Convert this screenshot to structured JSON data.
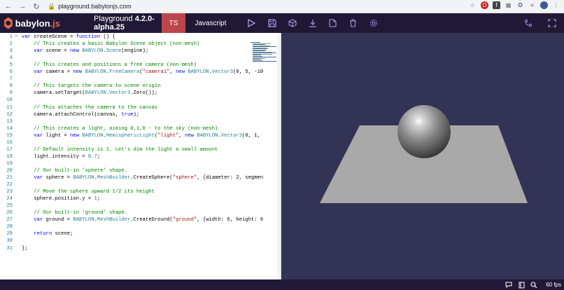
{
  "browser": {
    "url": "playground.babylonjs.com"
  },
  "header": {
    "logo_text": "babylon",
    "logo_suffix": ".js",
    "title_prefix": "Playground ",
    "version": "4.2.0-alpha.25",
    "tab_ts": "TS",
    "tab_js": "Javascript"
  },
  "editor": {
    "lines": [
      {
        "n": "1",
        "fold": "v",
        "parts": [
          [
            "kw",
            "var "
          ],
          [
            "",
            "createScene = "
          ],
          [
            "kw",
            "function"
          ],
          [
            "",
            " () {"
          ]
        ]
      },
      {
        "n": "2",
        "parts": [
          [
            "",
            "    "
          ],
          [
            "cm",
            "// This creates a basic Babylon Scene object (non-mesh)"
          ]
        ]
      },
      {
        "n": "3",
        "parts": [
          [
            "",
            "    "
          ],
          [
            "kw",
            "var "
          ],
          [
            "",
            "scene = "
          ],
          [
            "kw",
            "new "
          ],
          [
            "cls",
            "BABYLON"
          ],
          [
            "",
            "."
          ],
          [
            "cls",
            "Scene"
          ],
          [
            "",
            "(engine);"
          ]
        ]
      },
      {
        "n": "4",
        "parts": []
      },
      {
        "n": "5",
        "parts": [
          [
            "",
            "    "
          ],
          [
            "cm",
            "// This creates and positions a free camera (non-mesh)"
          ]
        ]
      },
      {
        "n": "6",
        "parts": [
          [
            "",
            "    "
          ],
          [
            "kw",
            "var "
          ],
          [
            "",
            "camera = "
          ],
          [
            "kw",
            "new "
          ],
          [
            "cls",
            "BABYLON"
          ],
          [
            "",
            "."
          ],
          [
            "cls",
            "FreeCamera"
          ],
          [
            "",
            "("
          ],
          [
            "str",
            "\"camera1\""
          ],
          [
            ",",
            ", "
          ],
          [
            "kw",
            "new "
          ],
          [
            "cls",
            "BABYLON"
          ],
          [
            "",
            "."
          ],
          [
            "cls",
            "Vector3"
          ],
          [
            "",
            "(0, 5, -10"
          ]
        ]
      },
      {
        "n": "7",
        "parts": []
      },
      {
        "n": "8",
        "parts": [
          [
            "",
            "    "
          ],
          [
            "cm",
            "// This targets the camera to scene origin"
          ]
        ]
      },
      {
        "n": "9",
        "parts": [
          [
            "",
            "    camera.setTarget("
          ],
          [
            "cls",
            "BABYLON"
          ],
          [
            "",
            "."
          ],
          [
            "cls",
            "Vector3"
          ],
          [
            "",
            ".Zero());"
          ]
        ]
      },
      {
        "n": "10",
        "parts": []
      },
      {
        "n": "11",
        "parts": [
          [
            "",
            "    "
          ],
          [
            "cm",
            "// This attaches the camera to the canvas"
          ]
        ]
      },
      {
        "n": "12",
        "parts": [
          [
            "",
            "    camera.attachControl(canvas, "
          ],
          [
            "kw",
            "true"
          ],
          [
            "",
            ");"
          ]
        ]
      },
      {
        "n": "13",
        "parts": []
      },
      {
        "n": "14",
        "parts": [
          [
            "",
            "    "
          ],
          [
            "cm",
            "// This creates a light, aiming 0,1,0 - to the sky (non-mesh)"
          ]
        ]
      },
      {
        "n": "15",
        "parts": [
          [
            "",
            "    "
          ],
          [
            "kw",
            "var "
          ],
          [
            "",
            "light = "
          ],
          [
            "kw",
            "new "
          ],
          [
            "cls",
            "BABYLON"
          ],
          [
            "",
            "."
          ],
          [
            "cls",
            "HemisphericLight"
          ],
          [
            "",
            "("
          ],
          [
            "str",
            "\"light\""
          ],
          [
            "",
            ", "
          ],
          [
            "kw",
            "new "
          ],
          [
            "cls",
            "BABYLON"
          ],
          [
            "",
            "."
          ],
          [
            "cls",
            "Vector3"
          ],
          [
            "",
            "(0, 1,"
          ]
        ]
      },
      {
        "n": "16",
        "parts": []
      },
      {
        "n": "17",
        "parts": [
          [
            "",
            "    "
          ],
          [
            "cm",
            "// Default intensity is 1. Let's dim the light a small amount"
          ]
        ]
      },
      {
        "n": "18",
        "parts": [
          [
            "",
            "    light.intensity = "
          ],
          [
            "num",
            "0.7"
          ],
          [
            "",
            ";"
          ]
        ]
      },
      {
        "n": "19",
        "parts": []
      },
      {
        "n": "20",
        "parts": [
          [
            "",
            "    "
          ],
          [
            "cm",
            "// Our built-in 'sphere' shape."
          ]
        ]
      },
      {
        "n": "21",
        "parts": [
          [
            "",
            "    "
          ],
          [
            "kw",
            "var "
          ],
          [
            "",
            "sphere = "
          ],
          [
            "cls",
            "BABYLON"
          ],
          [
            "",
            "."
          ],
          [
            "cls",
            "MeshBuilder"
          ],
          [
            "",
            ".CreateSphere("
          ],
          [
            "str",
            "\"sphere\""
          ],
          [
            "",
            ", {diameter: 2, segmen"
          ]
        ]
      },
      {
        "n": "22",
        "parts": []
      },
      {
        "n": "23",
        "parts": [
          [
            "",
            "    "
          ],
          [
            "cm",
            "// Move the sphere upward 1/2 its height"
          ]
        ]
      },
      {
        "n": "24",
        "parts": [
          [
            "",
            "    sphere.position.y = "
          ],
          [
            "num",
            "1"
          ],
          [
            "",
            ";"
          ]
        ]
      },
      {
        "n": "25",
        "parts": []
      },
      {
        "n": "26",
        "parts": [
          [
            "",
            "    "
          ],
          [
            "cm",
            "// Our built-in 'ground' shape."
          ]
        ]
      },
      {
        "n": "27",
        "parts": [
          [
            "",
            "    "
          ],
          [
            "kw",
            "var "
          ],
          [
            "",
            "ground = "
          ],
          [
            "cls",
            "BABYLON"
          ],
          [
            "",
            "."
          ],
          [
            "cls",
            "MeshBuilder"
          ],
          [
            "",
            ".CreateGround("
          ],
          [
            "str",
            "\"ground\""
          ],
          [
            "",
            ", {width: 6, height: 6"
          ]
        ]
      },
      {
        "n": "28",
        "parts": []
      },
      {
        "n": "29",
        "parts": [
          [
            "",
            "    "
          ],
          [
            "kw",
            "return "
          ],
          [
            "",
            "scene;"
          ]
        ]
      },
      {
        "n": "30",
        "parts": []
      },
      {
        "n": "31",
        "parts": [
          [
            "",
            "};"
          ]
        ]
      }
    ]
  },
  "footer": {
    "fps": "60 fps"
  },
  "colors": {
    "header_bg": "#201936",
    "accent": "#bb464b",
    "viewport_bg": "#333356",
    "icon": "#b08fe6"
  }
}
